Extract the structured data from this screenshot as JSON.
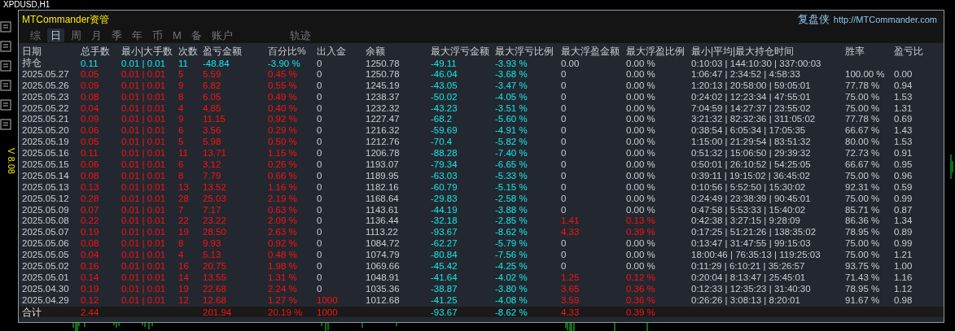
{
  "chart_title": "XPDUSD,H1",
  "version": "V 8.08",
  "panel": {
    "title": "MTCommander资管",
    "brand": "复盘侠",
    "link": "http://MTCommander.com"
  },
  "tabs": [
    {
      "label": "综",
      "selected": false
    },
    {
      "label": "日",
      "selected": true
    },
    {
      "label": "周",
      "selected": false
    },
    {
      "label": "月",
      "selected": false
    },
    {
      "label": "季",
      "selected": false
    },
    {
      "label": "年",
      "selected": false
    },
    {
      "label": "币",
      "selected": false
    },
    {
      "label": "M",
      "selected": false
    },
    {
      "label": "备",
      "selected": false
    },
    {
      "label": "账户",
      "selected": false
    },
    {
      "label": "轨迹",
      "selected": false
    }
  ],
  "table": {
    "columns": [
      "日期",
      "总手数",
      "最小|大手数",
      "次数",
      "盈亏金额",
      "百分比%",
      "出入金",
      "余额",
      "最大浮亏金额",
      "最大浮亏比例",
      "最大浮盈金额",
      "最大浮盈比例",
      "最小|平均|最大持仓时间",
      "胜率",
      "盈亏比"
    ],
    "rows": [
      {
        "kind": "position",
        "has_deposit": false,
        "has_float_profit": false,
        "cells": [
          "持仓",
          "0.11",
          "0.01 | 0.01",
          "11",
          "-48.84",
          "-3.90 %",
          "0",
          "1250.78",
          "-49.11",
          "-3.93 %",
          "0.00",
          "0.00 %",
          "0:10:03 | 144:10:30 | 337:00:03",
          "",
          ""
        ]
      },
      {
        "kind": "day",
        "has_deposit": false,
        "has_float_profit": false,
        "cells": [
          "2025.05.27",
          "0.05",
          "0.01 | 0.01",
          "5",
          "5.59",
          "0.45 %",
          "0",
          "1250.78",
          "-46.04",
          "-3.68 %",
          "0",
          "0.00 %",
          "1:06:47 | 2:34:52 | 4:58:33",
          "100.00 %",
          "0.00"
        ]
      },
      {
        "kind": "day",
        "has_deposit": false,
        "has_float_profit": false,
        "cells": [
          "2025.05.26",
          "0.09",
          "0.01 | 0.01",
          "9",
          "6.82",
          "0.55 %",
          "0",
          "1245.19",
          "-43.05",
          "-3.47 %",
          "0",
          "0.00 %",
          "1:20:13 | 20:58:00 | 59:05:01",
          "77.78 %",
          "0.94"
        ]
      },
      {
        "kind": "day",
        "has_deposit": false,
        "has_float_profit": false,
        "cells": [
          "2025.05.23",
          "0.08",
          "0.01 | 0.01",
          "8",
          "6.05",
          "0.49 %",
          "0",
          "1238.37",
          "-50.02",
          "-4.05 %",
          "0",
          "0.00 %",
          "0:24:02 | 12:23:34 | 47:55:01",
          "75.00 %",
          "1.53"
        ]
      },
      {
        "kind": "day",
        "has_deposit": false,
        "has_float_profit": false,
        "cells": [
          "2025.05.22",
          "0.04",
          "0.01 | 0.01",
          "4",
          "4.85",
          "0.40 %",
          "0",
          "1232.32",
          "-43.23",
          "-3.51 %",
          "0",
          "0.00 %",
          "7:04:59 | 14:27:37 | 23:55:02",
          "75.00 %",
          "1.31"
        ]
      },
      {
        "kind": "day",
        "has_deposit": false,
        "has_float_profit": false,
        "cells": [
          "2025.05.21",
          "0.09",
          "0.01 | 0.01",
          "9",
          "11.15",
          "0.92 %",
          "0",
          "1227.47",
          "-68.2",
          "-5.60 %",
          "0",
          "0.00 %",
          "3:21:32 | 82:32:36 | 311:05:02",
          "77.78 %",
          "0.69"
        ]
      },
      {
        "kind": "day",
        "has_deposit": false,
        "has_float_profit": false,
        "cells": [
          "2025.05.20",
          "0.06",
          "0.01 | 0.01",
          "6",
          "3.56",
          "0.29 %",
          "0",
          "1216.32",
          "-59.69",
          "-4.91 %",
          "0",
          "0.00 %",
          "0:38:54 | 6:05:34 | 17:05:35",
          "66.67 %",
          "1.43"
        ]
      },
      {
        "kind": "day",
        "has_deposit": false,
        "has_float_profit": false,
        "cells": [
          "2025.05.19",
          "0.05",
          "0.01 | 0.01",
          "5",
          "5.98",
          "0.50 %",
          "0",
          "1212.76",
          "-70.4",
          "-5.82 %",
          "0",
          "0.00 %",
          "1:15:00 | 21:29:54 | 83:51:32",
          "80.00 %",
          "1.53"
        ]
      },
      {
        "kind": "day",
        "has_deposit": false,
        "has_float_profit": false,
        "cells": [
          "2025.05.16",
          "0.11",
          "0.01 | 0.01",
          "11",
          "13.71",
          "1.15 %",
          "0",
          "1206.78",
          "-88.28",
          "-7.40 %",
          "0",
          "0.00 %",
          "0:51:32 | 15:06:50 | 29:39:32",
          "72.73 %",
          "0.91"
        ]
      },
      {
        "kind": "day",
        "has_deposit": false,
        "has_float_profit": false,
        "cells": [
          "2025.05.15",
          "0.06",
          "0.01 | 0.01",
          "6",
          "3.12",
          "0.26 %",
          "0",
          "1193.07",
          "-79.34",
          "-6.65 %",
          "0",
          "0.00 %",
          "0:50:01 | 26:10:52 | 54:25:05",
          "66.67 %",
          "0.95"
        ]
      },
      {
        "kind": "day",
        "has_deposit": false,
        "has_float_profit": false,
        "cells": [
          "2025.05.14",
          "0.08",
          "0.01 | 0.01",
          "8",
          "7.79",
          "0.66 %",
          "0",
          "1189.95",
          "-63.03",
          "-5.33 %",
          "0",
          "0.00 %",
          "0:39:11 | 19:15:02 | 36:45:02",
          "75.00 %",
          "0.96"
        ]
      },
      {
        "kind": "day",
        "has_deposit": false,
        "has_float_profit": false,
        "cells": [
          "2025.05.13",
          "0.13",
          "0.01 | 0.01",
          "13",
          "13.52",
          "1.16 %",
          "0",
          "1182.16",
          "-60.79",
          "-5.15 %",
          "0",
          "0.00 %",
          "0:10:56 | 5:52:50 | 15:30:02",
          "92.31 %",
          "0.59"
        ]
      },
      {
        "kind": "day",
        "has_deposit": false,
        "has_float_profit": false,
        "cells": [
          "2025.05.12",
          "0.28",
          "0.01 | 0.01",
          "28",
          "25.03",
          "2.19 %",
          "0",
          "1168.64",
          "-29.83",
          "-2.58 %",
          "0",
          "0.00 %",
          "0:24:49 | 23:38:39 | 90:45:01",
          "75.00 %",
          "0.99"
        ]
      },
      {
        "kind": "day",
        "has_deposit": false,
        "has_float_profit": false,
        "cells": [
          "2025.05.09",
          "0.07",
          "0.01 | 0.01",
          "7",
          "7.17",
          "0.63 %",
          "0",
          "1143.61",
          "-44.19",
          "-3.88 %",
          "0",
          "0.00 %",
          "0:47:58 | 5:53:33 | 15:40:02",
          "85.71 %",
          "0.87"
        ]
      },
      {
        "kind": "day",
        "has_deposit": false,
        "has_float_profit": true,
        "cells": [
          "2025.05.08",
          "0.22",
          "0.01 | 0.01",
          "22",
          "23.22",
          "2.09 %",
          "0",
          "1136.44",
          "-32.18",
          "-2.85 %",
          "1.41",
          "0.13 %",
          "0:42:38 | 3:27:15 | 9:28:09",
          "86.36 %",
          "1.34"
        ]
      },
      {
        "kind": "day",
        "has_deposit": false,
        "has_float_profit": true,
        "cells": [
          "2025.05.07",
          "0.19",
          "0.01 | 0.01",
          "19",
          "28.50",
          "2.63 %",
          "0",
          "1113.22",
          "-93.67",
          "-8.62 %",
          "4.33",
          "0.39 %",
          "0:17:25 | 51:21:26 | 138:35:02",
          "78.95 %",
          "0.89"
        ]
      },
      {
        "kind": "day",
        "has_deposit": false,
        "has_float_profit": false,
        "cells": [
          "2025.05.06",
          "0.08",
          "0.01 | 0.01",
          "8",
          "9.93",
          "0.92 %",
          "0",
          "1084.72",
          "-62.27",
          "-5.79 %",
          "0",
          "0.00 %",
          "0:13:47 | 31:47:55 | 99:15:03",
          "75.00 %",
          "0.99"
        ]
      },
      {
        "kind": "day",
        "has_deposit": false,
        "has_float_profit": false,
        "cells": [
          "2025.05.05",
          "0.04",
          "0.01 | 0.01",
          "4",
          "5.13",
          "0.48 %",
          "0",
          "1074.79",
          "-80.84",
          "-7.56 %",
          "0",
          "0.00 %",
          "18:00:46 | 76:35:13 | 119:25:03",
          "75.00 %",
          "1.21"
        ]
      },
      {
        "kind": "day",
        "has_deposit": false,
        "has_float_profit": false,
        "cells": [
          "2025.05.02",
          "0.16",
          "0.01 | 0.01",
          "16",
          "20.75",
          "1.98 %",
          "0",
          "1069.66",
          "-45.42",
          "-4.25 %",
          "0",
          "0.00 %",
          "0:11:29 | 6:10:21 | 35:26:57",
          "93.75 %",
          "1.00"
        ]
      },
      {
        "kind": "day",
        "has_deposit": false,
        "has_float_profit": true,
        "cells": [
          "2025.05.01",
          "0.14",
          "0.01 | 0.01",
          "14",
          "13.55",
          "1.31 %",
          "0",
          "1048.91",
          "-41.64",
          "-4.02 %",
          "1.25",
          "0.12 %",
          "0:20:04 | 8:13:47 | 25:45:01",
          "71.43 %",
          "1.16"
        ]
      },
      {
        "kind": "day",
        "has_deposit": false,
        "has_float_profit": true,
        "cells": [
          "2025.04.30",
          "0.19",
          "0.01 | 0.01",
          "19",
          "22.68",
          "2.24 %",
          "0",
          "1035.36",
          "-38.87",
          "-3.80 %",
          "3.65",
          "0.36 %",
          "0:12:33 | 12:35:23 | 31:40:30",
          "78.95 %",
          "1.12"
        ]
      },
      {
        "kind": "day",
        "has_deposit": true,
        "has_float_profit": true,
        "cells": [
          "2025.04.29",
          "0.12",
          "0.01 | 0.01",
          "12",
          "12.68",
          "1.27 %",
          "1000",
          "1012.68",
          "-41.25",
          "-4.08 %",
          "3.59",
          "0.36 %",
          "0:26:26 | 3:08:13 | 8:20:01",
          "91.67 %",
          "0.98"
        ]
      },
      {
        "kind": "total",
        "has_deposit": true,
        "has_float_profit": true,
        "cells": [
          "合计",
          "2.44",
          "",
          "",
          "201.94",
          "20.19 %",
          "1000",
          "",
          "-93.67",
          "-8.62 %",
          "4.33",
          "0.39 %",
          "",
          "",
          ""
        ]
      }
    ]
  }
}
